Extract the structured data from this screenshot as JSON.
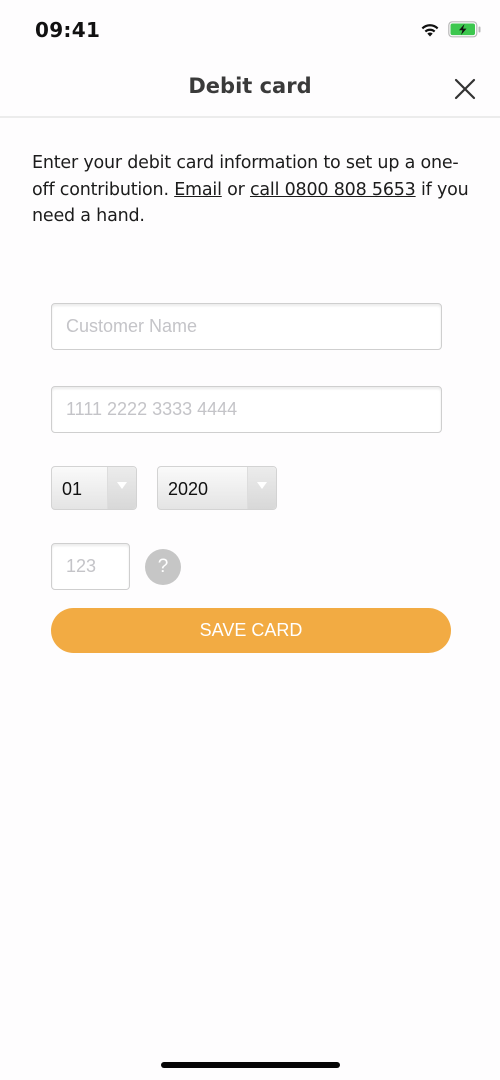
{
  "status_bar": {
    "time": "09:41",
    "icons": [
      "wifi-icon",
      "battery-charging-icon"
    ],
    "battery_color": "#3cc74e"
  },
  "nav": {
    "title": "Debit card",
    "close_icon": "close-icon"
  },
  "intro": {
    "text_before": "Enter your debit card information to set up a one-off contribution. ",
    "email_link": "Email",
    "text_middle": " or ",
    "call_link": "call 0800 808 5653",
    "text_after": " if you need a hand."
  },
  "form": {
    "name_field": {
      "placeholder": "Customer Name",
      "value": ""
    },
    "card_field": {
      "placeholder": "1111 2222 3333 4444",
      "value": ""
    },
    "month_select": {
      "value": "01"
    },
    "year_select": {
      "value": "2020"
    },
    "cvv_field": {
      "placeholder": "123",
      "value": ""
    },
    "help_label": "?",
    "save_label": "SAVE CARD"
  },
  "colors": {
    "accent": "#f2ab43",
    "help_bg": "#c6c6c6"
  }
}
